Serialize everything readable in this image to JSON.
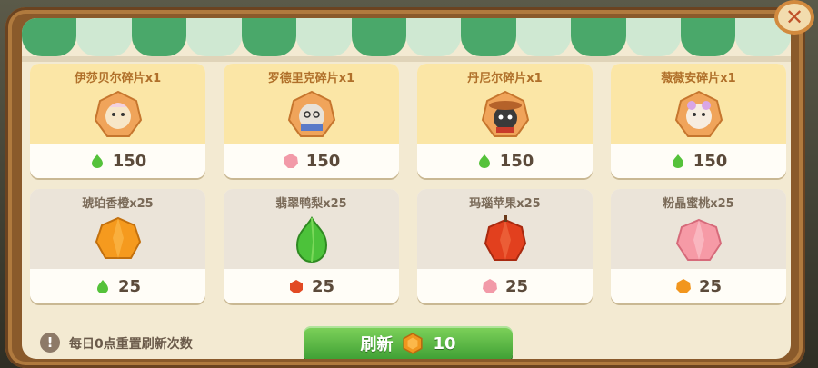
{
  "shop": {
    "items": [
      {
        "name": "伊莎贝尔碎片x1",
        "price": "150",
        "currency": "green-pear-icon",
        "item": "isabel-shard-icon",
        "tier": "gold"
      },
      {
        "name": "罗德里克碎片x1",
        "price": "150",
        "currency": "pink-peach-icon",
        "item": "roderick-shard-icon",
        "tier": "gold"
      },
      {
        "name": "丹尼尔碎片x1",
        "price": "150",
        "currency": "green-pear-icon",
        "item": "daniel-shard-icon",
        "tier": "gold"
      },
      {
        "name": "薇薇安碎片x1",
        "price": "150",
        "currency": "green-pear-icon",
        "item": "vivian-shard-icon",
        "tier": "gold"
      },
      {
        "name": "琥珀香橙x25",
        "price": "25",
        "currency": "green-pear-icon",
        "item": "amber-orange-icon",
        "tier": "silver"
      },
      {
        "name": "翡翠鸭梨x25",
        "price": "25",
        "currency": "red-apple-icon",
        "item": "jade-pear-icon",
        "tier": "silver"
      },
      {
        "name": "玛瑙苹果x25",
        "price": "25",
        "currency": "pink-peach-icon",
        "item": "agate-apple-icon",
        "tier": "silver"
      },
      {
        "name": "粉晶蜜桃x25",
        "price": "25",
        "currency": "orange-icon",
        "item": "pink-crystal-peach-icon",
        "tier": "silver"
      }
    ]
  },
  "footer": {
    "info_text": "每日0点重置刷新次数",
    "refresh_label": "刷新",
    "refresh_cost": "10",
    "refresh_currency": "orange-gem-icon"
  },
  "colors": {
    "panel": "#8a5a2b",
    "awning_green": "#4aa86a",
    "button_green": "#3d9e33"
  }
}
